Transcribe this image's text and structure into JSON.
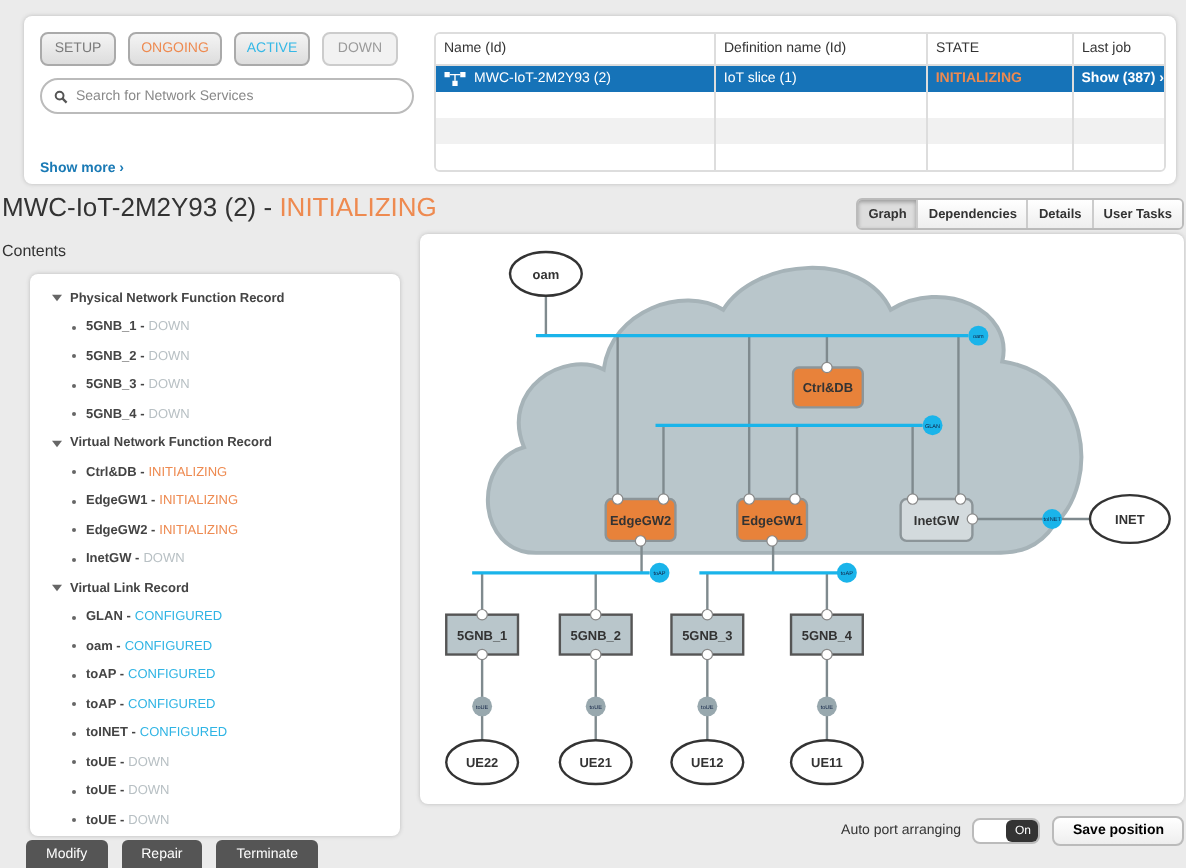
{
  "filters": [
    {
      "label": "SETUP",
      "color": "#7a7a7a",
      "disabled": false
    },
    {
      "label": "ONGOING",
      "color": "#ee8a50",
      "disabled": false
    },
    {
      "label": "ACTIVE",
      "color": "#35b8e6",
      "disabled": false
    },
    {
      "label": "DOWN",
      "color": "#9a9a9a",
      "disabled": true
    }
  ],
  "search": {
    "placeholder": "Search for Network Services"
  },
  "show_more": "Show more ›",
  "table": {
    "columns": [
      "Name (Id)",
      "Definition name (Id)",
      "STATE",
      "Last job"
    ],
    "rows": [
      {
        "selected": true,
        "color": "#ee8a50",
        "cells": [
          "MWC-IoT-2M2Y93 (2)",
          "IoT slice (1)",
          "INITIALIZING",
          "Show (387) ›"
        ]
      },
      {
        "selected": false,
        "cells": []
      },
      {
        "selected": false,
        "cells": []
      },
      {
        "selected": false,
        "cells": []
      }
    ]
  },
  "title": {
    "name": "MWC-IoT-2M2Y93 (2) -",
    "status": "INITIALIZING",
    "color": "#ee8a50"
  },
  "tabs": [
    {
      "label": "Graph",
      "selected": true
    },
    {
      "label": "Dependencies",
      "selected": false
    },
    {
      "label": "Details",
      "selected": false
    },
    {
      "label": "User Tasks",
      "selected": false
    }
  ],
  "contents": {
    "label": "Contents",
    "groups": [
      {
        "label": "Physical Network Function Record",
        "expanded": true,
        "children": [
          {
            "name": "5GNB_1 -",
            "status": "DOWN",
            "color": "#b8c0c4"
          },
          {
            "name": "5GNB_2 -",
            "status": "DOWN",
            "color": "#b8c0c4"
          },
          {
            "name": "5GNB_3 -",
            "status": "DOWN",
            "color": "#b8c0c4"
          },
          {
            "name": "5GNB_4 -",
            "status": "DOWN",
            "color": "#b8c0c4"
          }
        ]
      },
      {
        "label": "Virtual Network Function Record",
        "expanded": true,
        "children": [
          {
            "name": "Ctrl&DB -",
            "status": "INITIALIZING",
            "color": "#ee8a50"
          },
          {
            "name": "EdgeGW1 -",
            "status": "INITIALIZING",
            "color": "#ee8a50"
          },
          {
            "name": "EdgeGW2 -",
            "status": "INITIALIZING",
            "color": "#ee8a50"
          },
          {
            "name": "InetGW -",
            "status": "DOWN",
            "color": "#b8c0c4"
          }
        ]
      },
      {
        "label": "Virtual Link Record",
        "expanded": true,
        "children": [
          {
            "name": "GLAN -",
            "status": "CONFIGURED",
            "color": "#2fb4e4"
          },
          {
            "name": "oam -",
            "status": "CONFIGURED",
            "color": "#2fb4e4"
          },
          {
            "name": "toAP -",
            "status": "CONFIGURED",
            "color": "#2fb4e4"
          },
          {
            "name": "toAP -",
            "status": "CONFIGURED",
            "color": "#2fb4e4"
          },
          {
            "name": "toINET -",
            "status": "CONFIGURED",
            "color": "#2fb4e4"
          },
          {
            "name": "toUE -",
            "status": "DOWN",
            "color": "#b8c0c4"
          },
          {
            "name": "toUE -",
            "status": "DOWN",
            "color": "#b8c0c4"
          },
          {
            "name": "toUE -",
            "status": "DOWN",
            "color": "#b8c0c4"
          }
        ]
      }
    ]
  },
  "actions": [
    "Modify",
    "Repair",
    "Terminate"
  ],
  "graph": {
    "endpoints": [
      {
        "label": "oam"
      },
      {
        "label": "INET"
      },
      {
        "label": "UE22"
      },
      {
        "label": "UE21"
      },
      {
        "label": "UE12"
      },
      {
        "label": "UE11"
      }
    ],
    "vnfs": [
      {
        "label": "Ctrl&DB",
        "color": "#e8823a"
      },
      {
        "label": "EdgeGW2",
        "color": "#e8823a"
      },
      {
        "label": "EdgeGW1",
        "color": "#e8823a"
      },
      {
        "label": "InetGW",
        "color": "#d3dadd"
      }
    ],
    "pnfs": [
      {
        "label": "5GNB_1"
      },
      {
        "label": "5GNB_2"
      },
      {
        "label": "5GNB_3"
      },
      {
        "label": "5GNB_4"
      }
    ],
    "links": [
      {
        "label": "oam",
        "color": "#1ab4ea"
      },
      {
        "label": "GLAN",
        "color": "#1ab4ea"
      },
      {
        "label": "toINET",
        "color": "#1ab4ea"
      },
      {
        "label": "toAP",
        "color": "#1ab4ea"
      },
      {
        "label": "toAP",
        "color": "#1ab4ea"
      },
      {
        "label": "toUE",
        "color": "#98a8ae"
      },
      {
        "label": "toUE",
        "color": "#98a8ae"
      },
      {
        "label": "toUE",
        "color": "#98a8ae"
      },
      {
        "label": "toUE",
        "color": "#98a8ae"
      }
    ]
  },
  "toggle": {
    "label": "Auto port arranging",
    "on": true,
    "text": "On"
  },
  "save_button": "Save position"
}
